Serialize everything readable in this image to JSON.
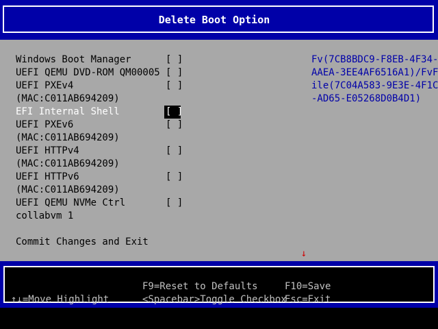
{
  "title": "Delete Boot Option",
  "boot_options": [
    {
      "label": "Windows Boot Manager",
      "checkbox": "[ ]"
    },
    {
      "label": "UEFI QEMU DVD-ROM QM00005",
      "checkbox": "[ ]"
    },
    {
      "label": "UEFI PXEv4",
      "checkbox": "[ ]"
    },
    {
      "label": "(MAC:C011AB694209)",
      "checkbox": null
    },
    {
      "label": "EFI Internal Shell",
      "checkbox": "[ ]",
      "selected": true
    },
    {
      "label": "UEFI PXEv6",
      "checkbox": "[ ]"
    },
    {
      "label": "(MAC:C011AB694209)",
      "checkbox": null
    },
    {
      "label": "UEFI HTTPv4",
      "checkbox": "[ ]"
    },
    {
      "label": "(MAC:C011AB694209)",
      "checkbox": null
    },
    {
      "label": "UEFI HTTPv6",
      "checkbox": "[ ]"
    },
    {
      "label": "(MAC:C011AB694209)",
      "checkbox": null
    },
    {
      "label": "UEFI QEMU NVMe Ctrl",
      "checkbox": "[ ]"
    },
    {
      "label": "collabvm 1",
      "checkbox": null
    }
  ],
  "commit_label": "Commit Changes and Exit",
  "help_lines": [
    "Fv(7CB8BDC9-F8EB-4F34-",
    "AAEA-3EE4AF6516A1)/FvF",
    "ile(7C04A583-9E3E-4F1C",
    "-AD65-E05268D0B4D1)"
  ],
  "scroll_indicator": "↓",
  "footer": {
    "move_highlight": "↑↓=Move Highlight",
    "reset_defaults": "F9=Reset to Defaults",
    "toggle_checkbox": "<Spacebar>Toggle Checkbox",
    "save": "F10=Save",
    "exit": "Esc=Exit"
  },
  "colors": {
    "title_band": "#0000a8",
    "body_background": "#a8a8a8",
    "help_text": "#0000a8",
    "highlight_background": "#000000",
    "scroll_arrow": "#d00000"
  }
}
